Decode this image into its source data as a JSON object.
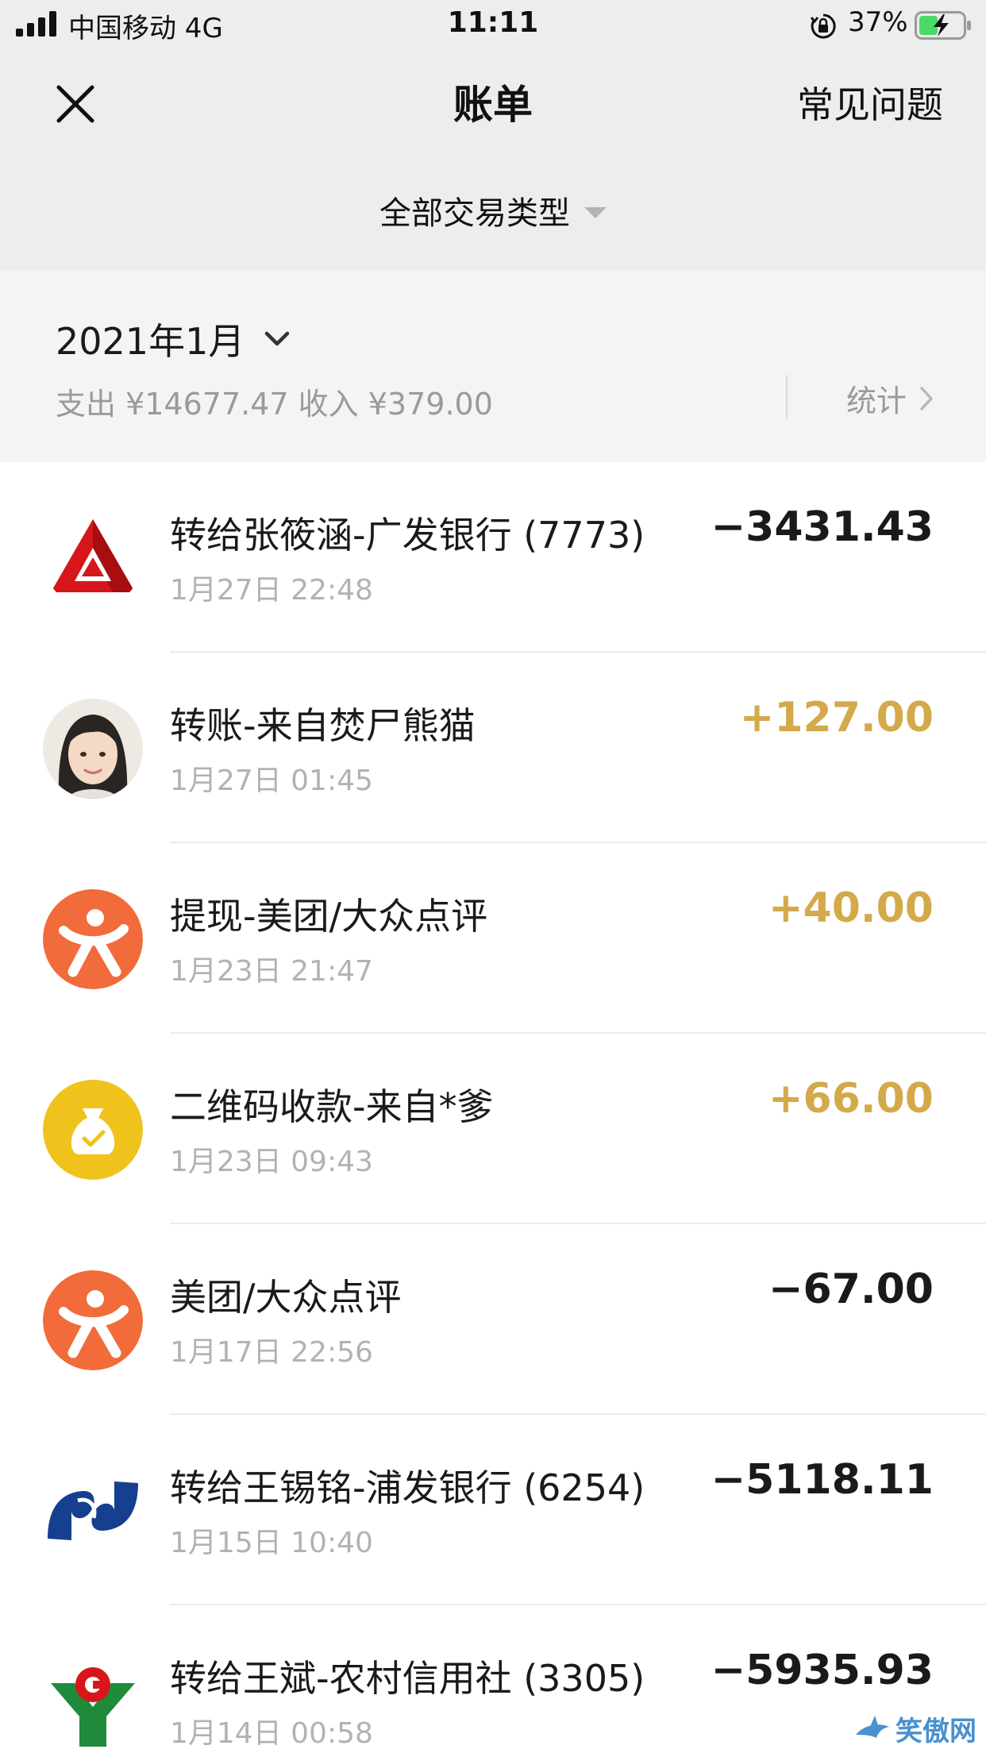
{
  "status_bar": {
    "carrier": "中国移动  4G",
    "time": "11:11",
    "battery": "37%"
  },
  "nav": {
    "title": "账单",
    "faq": "常见问题"
  },
  "filter": {
    "label": "全部交易类型"
  },
  "summary": {
    "month": "2021年1月",
    "totals": "支出 ¥14677.47 收入 ¥379.00",
    "stats": "统计"
  },
  "transactions": [
    {
      "title": "转给张筱涵-广发银行 (7773)",
      "time": "1月27日 22:48",
      "amount": "−3431.43",
      "icon": "cgb-bank-icon"
    },
    {
      "title": "转账-来自焚尸熊猫",
      "time": "1月27日 01:45",
      "amount": "+127.00",
      "icon": "avatar"
    },
    {
      "title": "提现-美团/大众点评",
      "time": "1月23日 21:47",
      "amount": "+40.00",
      "icon": "meituan-dianping-icon"
    },
    {
      "title": "二维码收款-来自*爹",
      "time": "1月23日 09:43",
      "amount": "+66.00",
      "icon": "money-bag-icon"
    },
    {
      "title": "美团/大众点评",
      "time": "1月17日 22:56",
      "amount": "−67.00",
      "icon": "meituan-dianping-icon"
    },
    {
      "title": "转给王锡铭-浦发银行 (6254)",
      "time": "1月15日 10:40",
      "amount": "−5118.11",
      "icon": "spdb-bank-icon"
    },
    {
      "title": "转给王斌-农村信用社 (3305)",
      "time": "1月14日 00:58",
      "amount": "−5935.93",
      "icon": "rural-credit-union-icon"
    }
  ],
  "colors": {
    "income": "#d4a94a",
    "expense": "#1a1a1a",
    "header_bg": "#ededed",
    "summary_bg": "#f4f4f4",
    "dianping_orange": "#f26b3a",
    "money_bag_yellow": "#f0c21c"
  },
  "watermark": "笑傲网"
}
